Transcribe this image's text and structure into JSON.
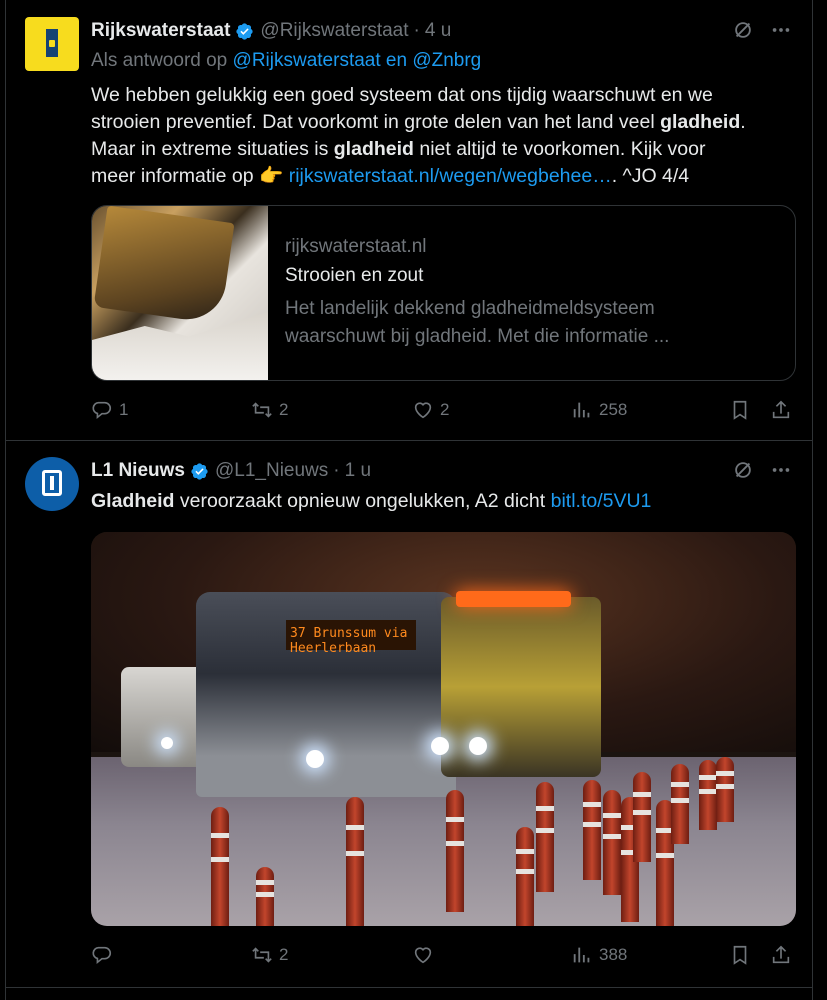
{
  "posts": [
    {
      "name": "Rijkswaterstaat",
      "handle": "@Rijkswaterstaat",
      "time": "4 u",
      "reply_prefix": "Als antwoord op ",
      "reply_targets": "@Rijkswaterstaat en @Znbrg",
      "text_lines": [
        "We hebben gelukkig een goed systeem dat ons tijdig waarschuwt en we",
        "strooien preventief. Dat voorkomt in grote delen van het land veel ",
        "gladheid",
        ".",
        "Maar in extreme situaties is ",
        "gladheid",
        " niet altijd te voorkomen. Kijk voor",
        "meer informatie op ",
        "👉",
        "rijkswaterstaat.nl/wegen/wegbehee…",
        ". ^JO 4/4"
      ],
      "card": {
        "domain": "rijkswaterstaat.nl",
        "title": "Strooien en zout",
        "description_lines": [
          "Het landelijk dekkend gladheidmeldsysteem",
          "waarschuwt bij gladheid. Met die informatie ..."
        ]
      },
      "stats": {
        "replies": "1",
        "reposts": "2",
        "likes": "2",
        "views": "258"
      }
    },
    {
      "name": "L1 Nieuws",
      "handle": "@L1_Nieuws",
      "time": "1 u",
      "text_bold": "Gladheid",
      "text_rest": " veroorzaakt opnieuw ongelukken, A2 dicht ",
      "text_link": "bitl.to/5VU1",
      "media": {
        "bus_sign": "37 Brunssum via Heerlerbaan"
      },
      "stats": {
        "replies": "",
        "reposts": "2",
        "likes": "",
        "views": "388"
      }
    }
  ],
  "colors": {
    "background": "#000000",
    "text": "#e7e9ea",
    "muted": "#71767b",
    "link": "#1d9bf0",
    "border": "#2f3336",
    "verified": "#1d9bf0",
    "rws_brand": "#f7dc1e",
    "l1_brand": "#0d5ea8"
  },
  "icons": {
    "verified": "verified-badge-icon",
    "grok": "grok-icon",
    "more": "more-icon",
    "reply": "reply-icon",
    "repost": "repost-icon",
    "like": "heart-icon",
    "views": "views-icon",
    "bookmark": "bookmark-icon",
    "share": "share-icon"
  }
}
